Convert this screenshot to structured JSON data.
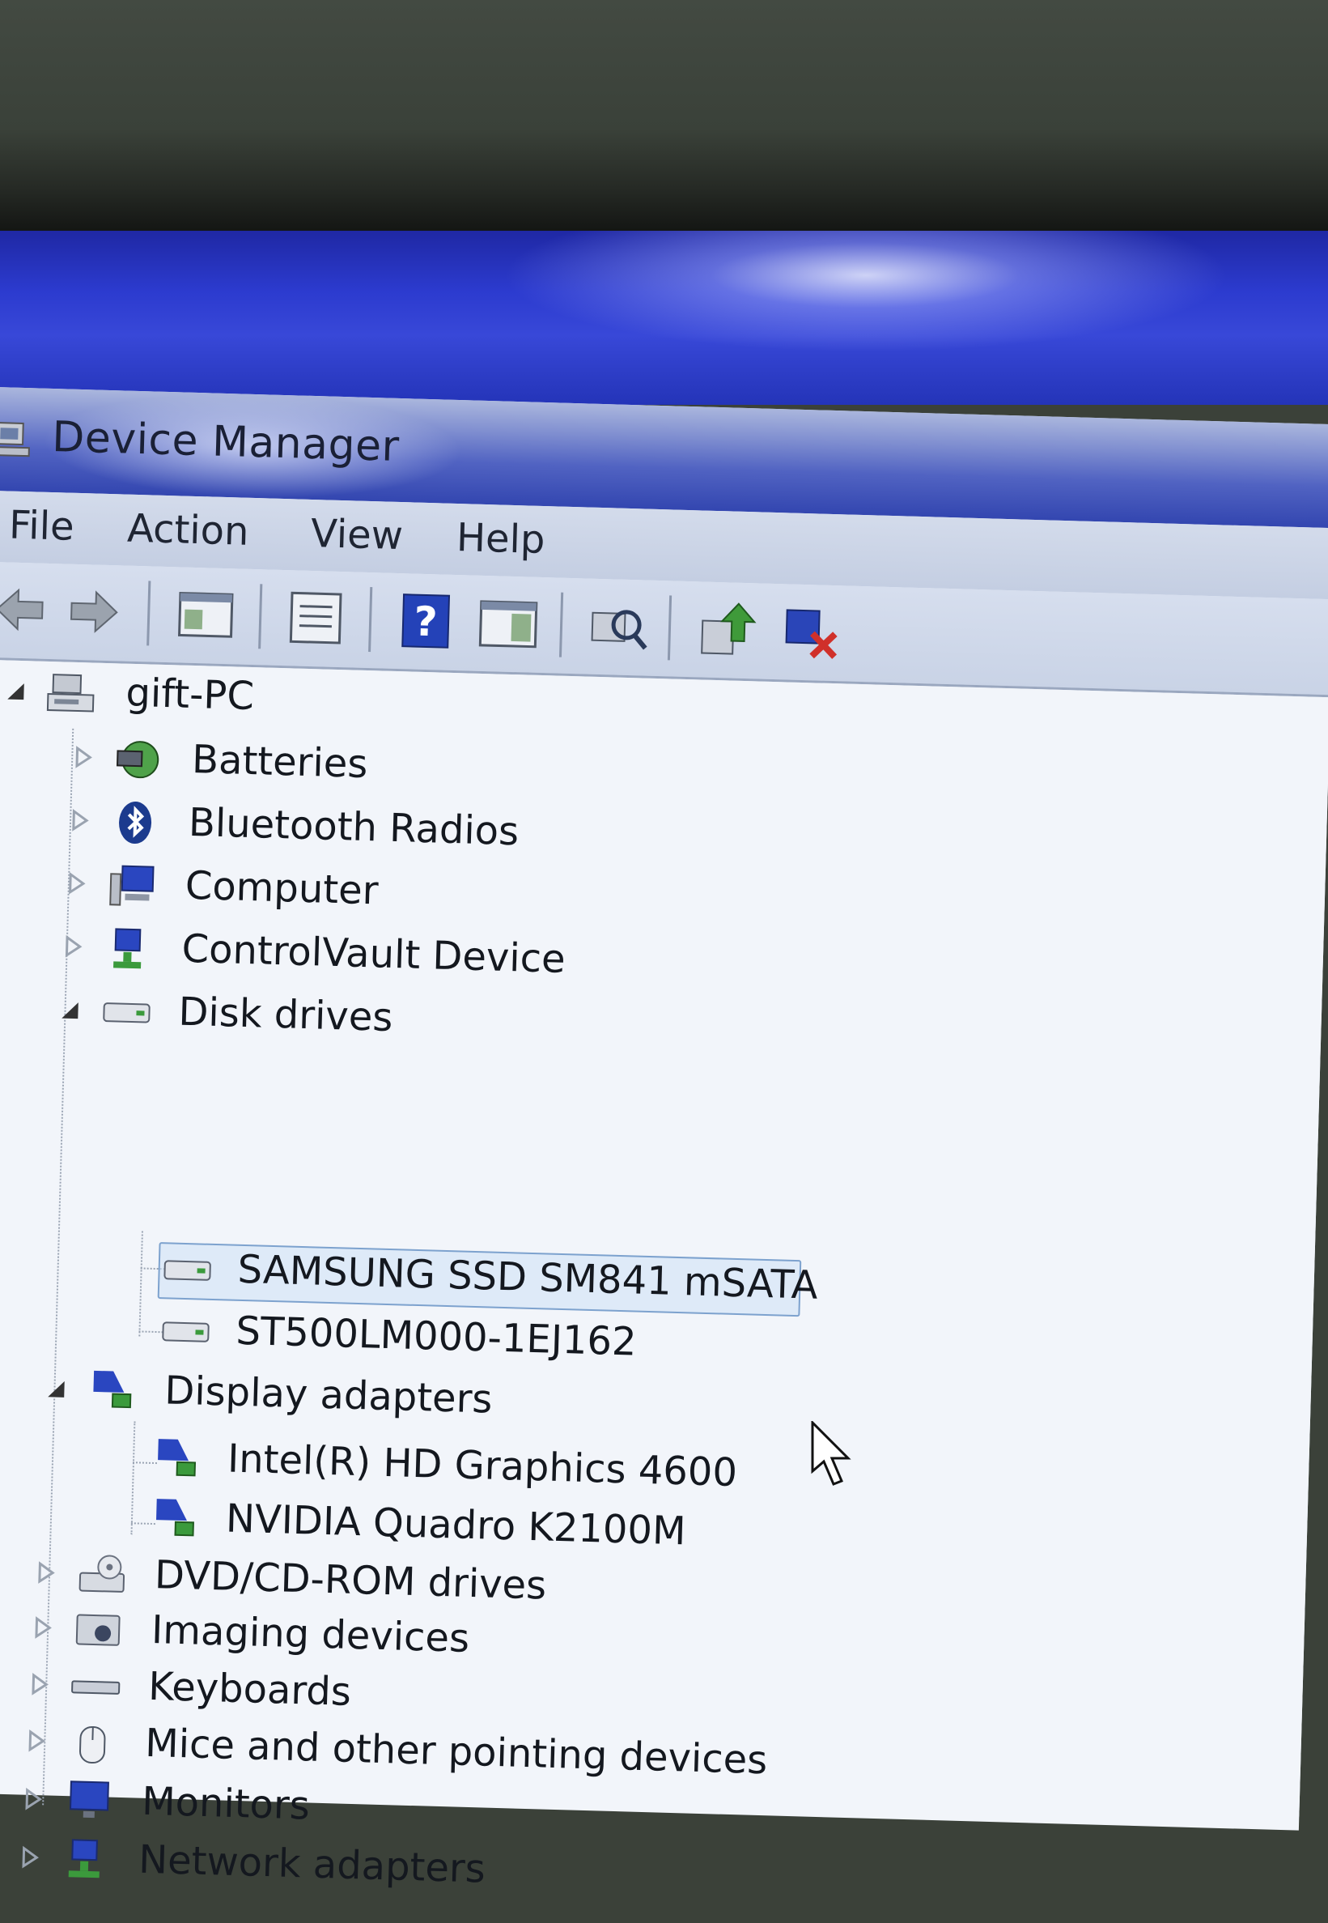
{
  "window": {
    "title": "Device Manager"
  },
  "menu": {
    "file": "File",
    "action": "Action",
    "view": "View",
    "help": "Help"
  },
  "toolbar": {
    "buttons": [
      "back-arrow-icon",
      "forward-arrow-icon",
      "show-hide-console-tree-icon",
      "properties-icon",
      "help-icon",
      "show-action-pane-icon",
      "scan-hardware-changes-icon",
      "update-driver-icon",
      "uninstall-device-icon"
    ]
  },
  "tree": {
    "root": "gift-PC",
    "categories": {
      "batteries": "Batteries",
      "bluetooth": "Bluetooth Radios",
      "computer": "Computer",
      "controlvault": "ControlVault Device",
      "disk_drives": "Disk drives",
      "display_adapters": "Display adapters",
      "dvd": "DVD/CD-ROM drives",
      "imaging": "Imaging devices",
      "keyboards": "Keyboards",
      "mice": "Mice and other pointing devices",
      "monitors": "Monitors",
      "network": "Network adapters"
    },
    "disk_drives": [
      "SAMSUNG SSD SM841 mSATA",
      "ST500LM000-1EJ162"
    ],
    "display_adapters": [
      "Intel(R) HD Graphics 4600",
      "NVIDIA Quadro K2100M"
    ],
    "selected": "SAMSUNG SSD SM841 mSATA"
  },
  "colors": {
    "desktop": "#2c3bcf",
    "titlebar": "#5163c2",
    "tree_background": "#f2f5fa",
    "selection": "#7da2ce"
  }
}
